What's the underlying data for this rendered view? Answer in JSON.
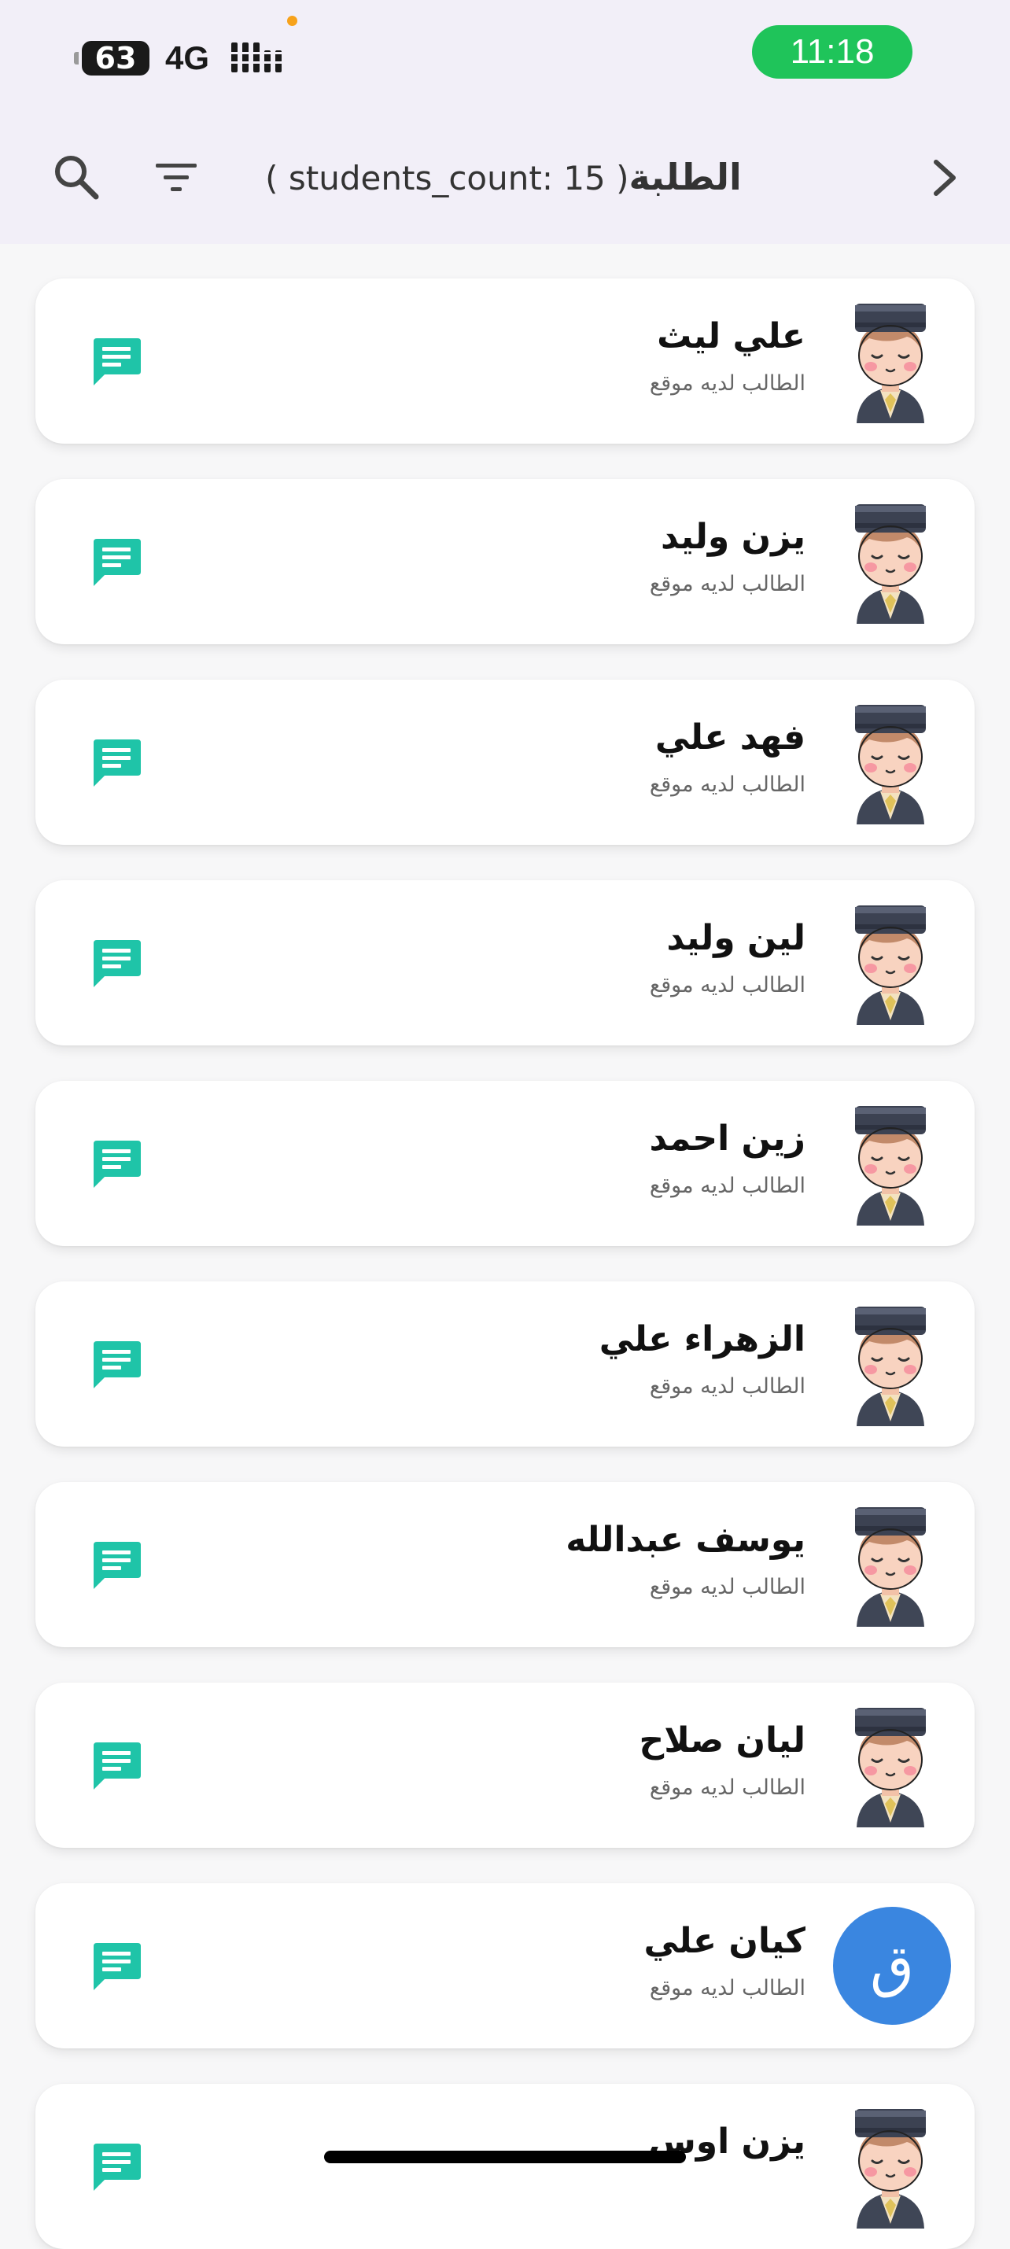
{
  "status_bar": {
    "battery": "63",
    "network": "4G",
    "time": "11:18"
  },
  "app_bar": {
    "title_arabic": "الطلبة",
    "title_count": "( students_count: 15 )"
  },
  "students": [
    {
      "name": "علي ليث",
      "status": "الطالب لديه موقع",
      "avatar": "student-avatar"
    },
    {
      "name": "يزن وليد",
      "status": "الطالب لديه موقع",
      "avatar": "student-avatar"
    },
    {
      "name": "فهد علي",
      "status": "الطالب لديه موقع",
      "avatar": "student-avatar"
    },
    {
      "name": "لين وليد",
      "status": "الطالب لديه موقع",
      "avatar": "student-avatar"
    },
    {
      "name": "زين احمد",
      "status": "الطالب لديه موقع",
      "avatar": "student-avatar"
    },
    {
      "name": "الزهراء علي",
      "status": "الطالب لديه موقع",
      "avatar": "student-avatar"
    },
    {
      "name": "يوسف عبدالله",
      "status": "الطالب لديه موقع",
      "avatar": "student-avatar"
    },
    {
      "name": "ليان صلاح",
      "status": "الطالب لديه موقع",
      "avatar": "student-avatar"
    },
    {
      "name": "كيان علي",
      "status": "الطالب لديه موقع",
      "avatar": "initial-avatar",
      "initial": "ق"
    },
    {
      "name": "يزن اوس",
      "status": "",
      "avatar": "student-avatar"
    }
  ],
  "colors": {
    "accent": "#1fc4a8",
    "header_bg": "#f2eff8",
    "initial_avatar_bg": "#3a86e0"
  }
}
